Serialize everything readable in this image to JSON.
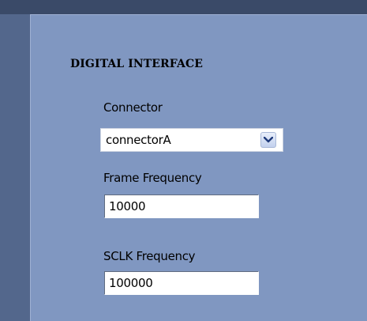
{
  "digital_interface": {
    "section_title": "DIGITAL INTERFACE",
    "connector": {
      "label": "Connector",
      "selected_value": "connectorA",
      "arrow_icon": "chevron-down-icon"
    },
    "frame_frequency": {
      "label": "Frame Frequency",
      "value": "10000"
    },
    "sclk_frequency": {
      "label": "SCLK Frequency",
      "value": "100000"
    }
  },
  "colors": {
    "panel_background": "#8097c1",
    "outer_background": "#4e5f80"
  }
}
